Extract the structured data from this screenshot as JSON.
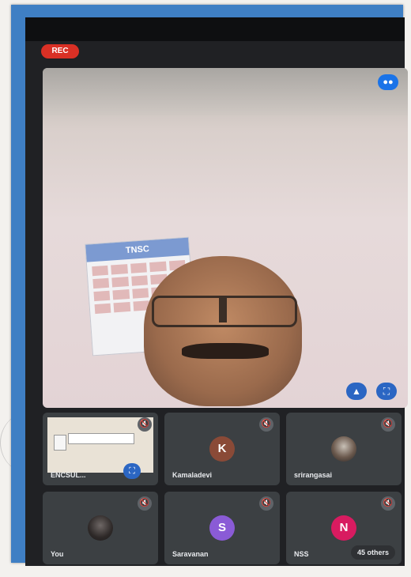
{
  "recording": {
    "label": "REC"
  },
  "main_video": {
    "calendar_label": "TNSC",
    "icons": {
      "speaking": "speaking-indicator-icon",
      "pin": "pin-icon",
      "fullscreen": "fullscreen-icon"
    }
  },
  "tiles": [
    {
      "name": "ENCSUL...",
      "type": "presentation",
      "icon": "mic-off-icon"
    },
    {
      "name": "Kamaladevi",
      "avatar_letter": "K",
      "avatar_color": "#8a4a37",
      "icon": "mic-off-icon"
    },
    {
      "name": "srirangasai",
      "type": "photo",
      "icon": "mic-off-icon"
    },
    {
      "name": "You",
      "type": "photo",
      "icon": "mic-off-icon"
    },
    {
      "name": "Saravanan",
      "avatar_letter": "S",
      "avatar_color": "#8a5bd6",
      "icon": "mic-off-icon"
    },
    {
      "name": "NSS",
      "avatar_letter": "N",
      "avatar_color": "#d81b60",
      "icon": "mic-off-icon",
      "others_label": "45 others"
    }
  ],
  "colors": {
    "accent": "#1a73e8",
    "rec": "#d93025",
    "frame": "#3f7fc4",
    "tile": "#3c4043"
  }
}
